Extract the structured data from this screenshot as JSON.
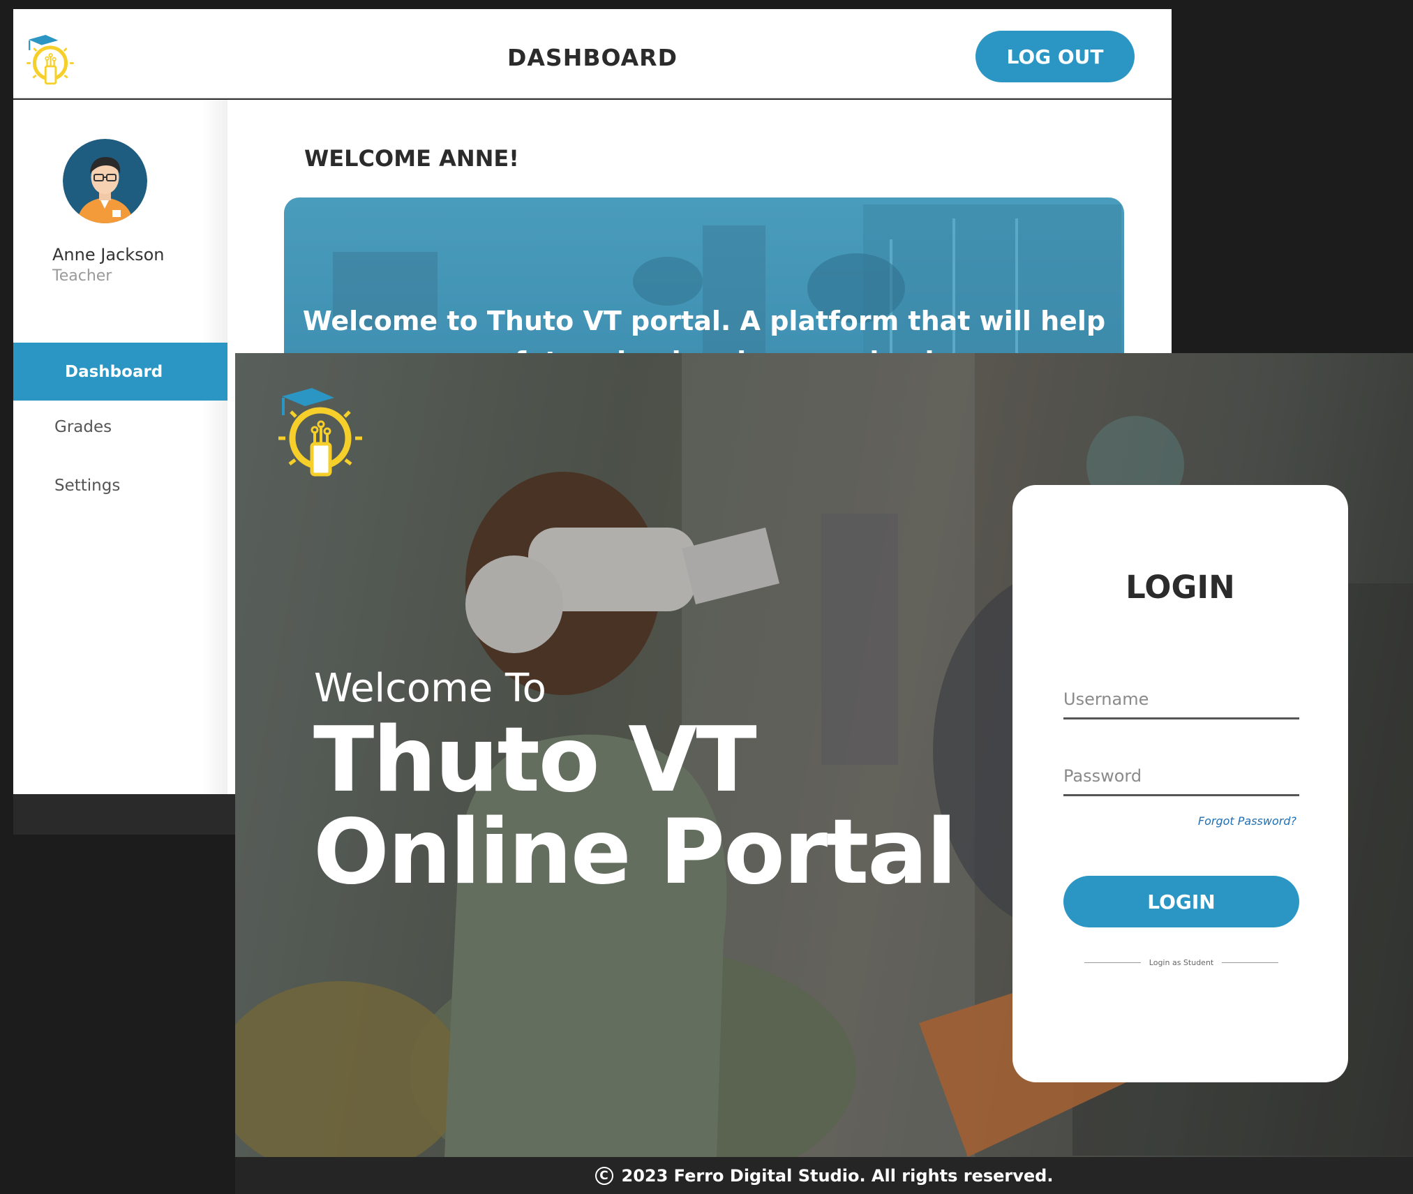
{
  "dashboard": {
    "title": "DASHBOARD",
    "logout_label": "LOG OUT",
    "user": {
      "name": "Anne Jackson",
      "role": "Teacher"
    },
    "nav": [
      {
        "label": "Dashboard",
        "active": true
      },
      {
        "label": "Grades",
        "active": false
      },
      {
        "label": "Settings",
        "active": false
      }
    ],
    "welcome_heading": "WELCOME ANNE!",
    "banner_text": "Welcome to Thuto VT portal. A platform that will help our future leaders learn and gain"
  },
  "login": {
    "hero_welcome": "Welcome To",
    "hero_title_line1": "Thuto VT",
    "hero_title_line2": "Online Portal",
    "card_title": "LOGIN",
    "username_placeholder": "Username",
    "password_placeholder": "Password",
    "forgot_label": "Forgot Password?",
    "login_button": "LOGIN",
    "student_link": "Login as Student"
  },
  "footer": {
    "copyright_symbol": "C",
    "text": "2023 Ferro Digital Studio. All rights reserved."
  },
  "colors": {
    "accent": "#2b96c4",
    "logo_yellow": "#f6cf2a",
    "logo_blue": "#2b96c4"
  },
  "icons": {
    "logo": "lightbulb-phone-graduation-cap-icon",
    "avatar": "teacher-avatar-icon",
    "copyright": "copyright-icon"
  }
}
